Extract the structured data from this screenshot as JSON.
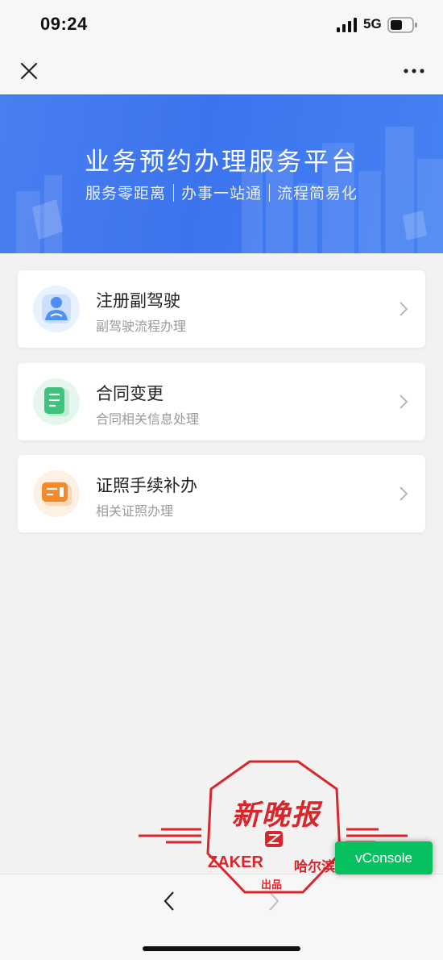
{
  "status_bar": {
    "time": "09:24",
    "network": "5G",
    "icons": [
      "signal-icon",
      "battery-icon"
    ]
  },
  "nav_bar": {
    "icons": [
      "close-icon",
      "more-icon"
    ]
  },
  "banner": {
    "title": "业务预约办理服务平台",
    "subtitle_parts": [
      "服务零距离",
      "办事一站通",
      "流程简易化"
    ]
  },
  "services": [
    {
      "title": "注册副驾驶",
      "desc": "副驾驶流程办理",
      "icon": "driver-icon",
      "color": "#4d8ff3"
    },
    {
      "title": "合同变更",
      "desc": "合同相关信息处理",
      "icon": "document-icon",
      "color": "#3fc27c"
    },
    {
      "title": "证照手续补办",
      "desc": "相关证照办理",
      "icon": "license-icon",
      "color": "#f48a2c"
    }
  ],
  "bottom_bar": {
    "icons": [
      "nav-back-icon",
      "nav-forward-icon"
    ]
  },
  "vconsole": {
    "label": "vConsole"
  },
  "watermark": {
    "calligraphy": "新晚报",
    "brand": "ZAKER",
    "city": "哈尔滨",
    "note": "出品",
    "color": "#d8262b"
  }
}
